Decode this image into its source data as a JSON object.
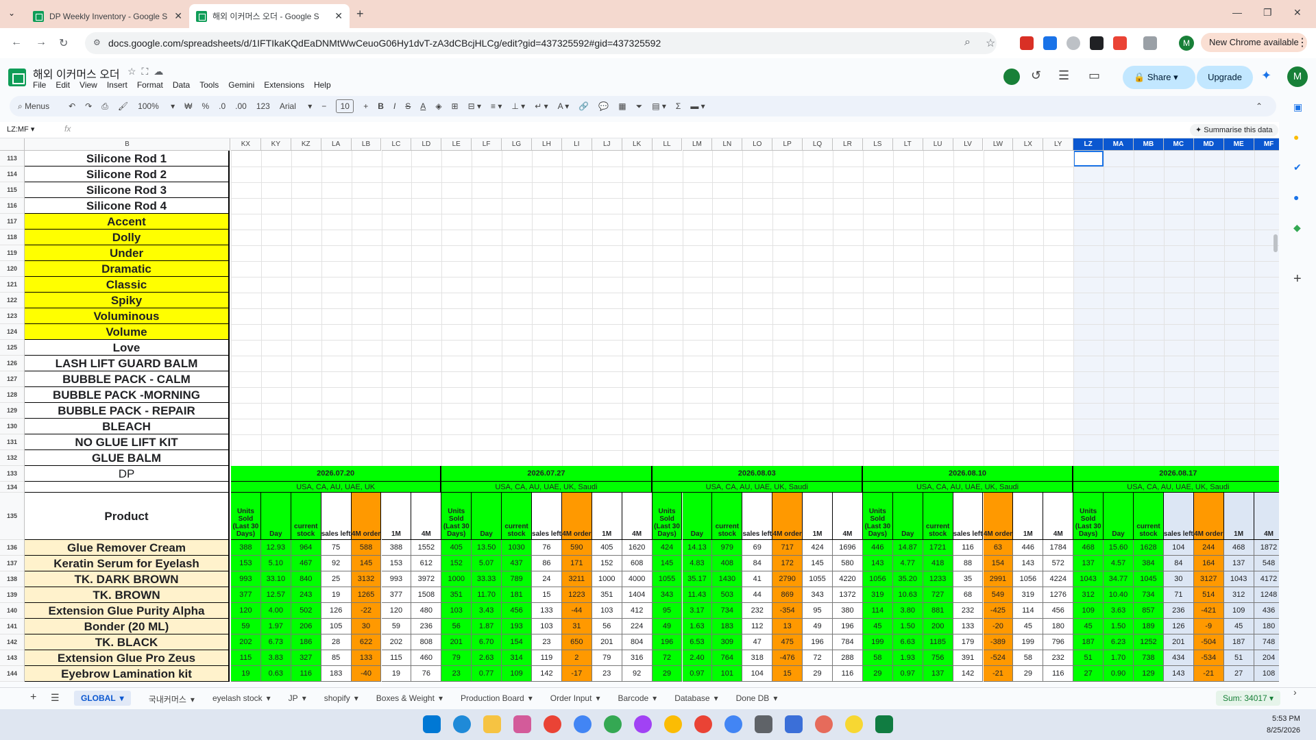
{
  "browser": {
    "tabs": [
      {
        "title": "DP Weekly Inventory - Google S",
        "active": false
      },
      {
        "title": "해외 이커머스 오더 - Google S",
        "active": true
      }
    ],
    "url": "docs.google.com/spreadsheets/d/1IFTIkaKQdEaDNMtWwCeuoG06Hy1dvT-zA3dCBcjHLCg/edit?gid=437325592#gid=437325592",
    "new_chrome_label": "New Chrome available",
    "profile_initial": "M"
  },
  "doc": {
    "title": "해외 이커머스 오더",
    "menu": [
      "File",
      "Edit",
      "View",
      "Insert",
      "Format",
      "Data",
      "Tools",
      "Gemini",
      "Extensions",
      "Help"
    ],
    "share_label": "Share",
    "upgrade_label": "Upgrade",
    "user_initial": "M"
  },
  "toolbar": {
    "menus_label": "Menus",
    "zoom": "100%",
    "font": "Arial",
    "font_size": "10",
    "format_number": "123"
  },
  "formula_bar": {
    "name_box": "LZ:MF",
    "fx": "fx",
    "summarise": "Summarise this data"
  },
  "columns": [
    "KX",
    "KY",
    "KZ",
    "LA",
    "LB",
    "LC",
    "LD",
    "LE",
    "LF",
    "LG",
    "LH",
    "LI",
    "LJ",
    "LK",
    "LL",
    "LM",
    "LN",
    "LO",
    "LP",
    "LQ",
    "LR",
    "LS",
    "LT",
    "LU",
    "LV",
    "LW",
    "LX",
    "LY",
    "LZ",
    "MA",
    "MB",
    "MC",
    "MD",
    "ME",
    "MF"
  ],
  "col_b_header": "B",
  "rows_upper": [
    {
      "n": "113",
      "label": "Silicone Rod 1",
      "style": "white"
    },
    {
      "n": "114",
      "label": "Silicone Rod 2",
      "style": "white"
    },
    {
      "n": "115",
      "label": "Silicone Rod 3",
      "style": "white"
    },
    {
      "n": "116",
      "label": "Silicone Rod 4",
      "style": "white"
    },
    {
      "n": "117",
      "label": "Accent",
      "style": "yellow"
    },
    {
      "n": "118",
      "label": "Dolly",
      "style": "yellow"
    },
    {
      "n": "119",
      "label": "Under",
      "style": "yellow"
    },
    {
      "n": "120",
      "label": "Dramatic",
      "style": "yellow"
    },
    {
      "n": "121",
      "label": "Classic",
      "style": "yellow"
    },
    {
      "n": "122",
      "label": "Spiky",
      "style": "yellow"
    },
    {
      "n": "123",
      "label": "Voluminous",
      "style": "yellow"
    },
    {
      "n": "124",
      "label": "Volume",
      "style": "yellow"
    },
    {
      "n": "125",
      "label": "Love",
      "style": "white"
    },
    {
      "n": "126",
      "label": "LASH LIFT GUARD BALM",
      "style": "white"
    },
    {
      "n": "127",
      "label": "BUBBLE PACK - CALM",
      "style": "white"
    },
    {
      "n": "128",
      "label": "BUBBLE PACK -MORNING",
      "style": "white"
    },
    {
      "n": "129",
      "label": "BUBBLE PACK - REPAIR",
      "style": "white"
    },
    {
      "n": "130",
      "label": "BLEACH",
      "style": "white"
    },
    {
      "n": "131",
      "label": "NO GLUE LIFT KIT",
      "style": "white"
    },
    {
      "n": "132",
      "label": "GLUE BALM",
      "style": "white"
    }
  ],
  "row133": {
    "n": "133",
    "label": "DP"
  },
  "row134": {
    "n": "134"
  },
  "row135": {
    "n": "135",
    "label": "Product"
  },
  "weeks": [
    {
      "date": "2026.07.20",
      "region": "USA, CA, AU, UAE, UK"
    },
    {
      "date": "2026.07.27",
      "region": "USA, CA, AU, UAE, UK, Saudi"
    },
    {
      "date": "2026.08.03",
      "region": "USA, CA, AU, UAE, UK, Saudi"
    },
    {
      "date": "2026.08.10",
      "region": "USA, CA, AU, UAE, UK, Saudi"
    },
    {
      "date": "2026.08.17",
      "region": "USA, CA, AU, UAE, UK, Saudi"
    }
  ],
  "subheaders": [
    "Units Sold (Last 30 Days)",
    "Day",
    "current stock",
    "sales left",
    "4M order",
    "1M",
    "4M"
  ],
  "products": [
    {
      "n": "136",
      "name": "Glue Remover Cream",
      "v": [
        [
          "388",
          "12.93",
          "964",
          "75",
          "588",
          "388",
          "1552"
        ],
        [
          "405",
          "13.50",
          "1030",
          "76",
          "590",
          "405",
          "1620"
        ],
        [
          "424",
          "14.13",
          "979",
          "69",
          "717",
          "424",
          "1696"
        ],
        [
          "446",
          "14.87",
          "1721",
          "116",
          "63",
          "446",
          "1784"
        ],
        [
          "468",
          "15.60",
          "1628",
          "104",
          "244",
          "468",
          "1872"
        ]
      ]
    },
    {
      "n": "137",
      "name": "Keratin Serum for Eyelash",
      "v": [
        [
          "153",
          "5.10",
          "467",
          "92",
          "145",
          "153",
          "612"
        ],
        [
          "152",
          "5.07",
          "437",
          "86",
          "171",
          "152",
          "608"
        ],
        [
          "145",
          "4.83",
          "408",
          "84",
          "172",
          "145",
          "580"
        ],
        [
          "143",
          "4.77",
          "418",
          "88",
          "154",
          "143",
          "572"
        ],
        [
          "137",
          "4.57",
          "384",
          "84",
          "164",
          "137",
          "548"
        ]
      ]
    },
    {
      "n": "138",
      "name": "TK. DARK BROWN",
      "v": [
        [
          "993",
          "33.10",
          "840",
          "25",
          "3132",
          "993",
          "3972"
        ],
        [
          "1000",
          "33.33",
          "789",
          "24",
          "3211",
          "1000",
          "4000"
        ],
        [
          "1055",
          "35.17",
          "1430",
          "41",
          "2790",
          "1055",
          "4220"
        ],
        [
          "1056",
          "35.20",
          "1233",
          "35",
          "2991",
          "1056",
          "4224"
        ],
        [
          "1043",
          "34.77",
          "1045",
          "30",
          "3127",
          "1043",
          "4172"
        ]
      ]
    },
    {
      "n": "139",
      "name": "TK. BROWN",
      "v": [
        [
          "377",
          "12.57",
          "243",
          "19",
          "1265",
          "377",
          "1508"
        ],
        [
          "351",
          "11.70",
          "181",
          "15",
          "1223",
          "351",
          "1404"
        ],
        [
          "343",
          "11.43",
          "503",
          "44",
          "869",
          "343",
          "1372"
        ],
        [
          "319",
          "10.63",
          "727",
          "68",
          "549",
          "319",
          "1276"
        ],
        [
          "312",
          "10.40",
          "734",
          "71",
          "514",
          "312",
          "1248"
        ]
      ]
    },
    {
      "n": "140",
      "name": "Extension Glue Purity Alpha",
      "v": [
        [
          "120",
          "4.00",
          "502",
          "126",
          "-22",
          "120",
          "480"
        ],
        [
          "103",
          "3.43",
          "456",
          "133",
          "-44",
          "103",
          "412"
        ],
        [
          "95",
          "3.17",
          "734",
          "232",
          "-354",
          "95",
          "380"
        ],
        [
          "114",
          "3.80",
          "881",
          "232",
          "-425",
          "114",
          "456"
        ],
        [
          "109",
          "3.63",
          "857",
          "236",
          "-421",
          "109",
          "436"
        ]
      ]
    },
    {
      "n": "141",
      "name": "Bonder (20 ML)",
      "v": [
        [
          "59",
          "1.97",
          "206",
          "105",
          "30",
          "59",
          "236"
        ],
        [
          "56",
          "1.87",
          "193",
          "103",
          "31",
          "56",
          "224"
        ],
        [
          "49",
          "1.63",
          "183",
          "112",
          "13",
          "49",
          "196"
        ],
        [
          "45",
          "1.50",
          "200",
          "133",
          "-20",
          "45",
          "180"
        ],
        [
          "45",
          "1.50",
          "189",
          "126",
          "-9",
          "45",
          "180"
        ]
      ]
    },
    {
      "n": "142",
      "name": "TK. BLACK",
      "v": [
        [
          "202",
          "6.73",
          "186",
          "28",
          "622",
          "202",
          "808"
        ],
        [
          "201",
          "6.70",
          "154",
          "23",
          "650",
          "201",
          "804"
        ],
        [
          "196",
          "6.53",
          "309",
          "47",
          "475",
          "196",
          "784"
        ],
        [
          "199",
          "6.63",
          "1185",
          "179",
          "-389",
          "199",
          "796"
        ],
        [
          "187",
          "6.23",
          "1252",
          "201",
          "-504",
          "187",
          "748"
        ]
      ]
    },
    {
      "n": "143",
      "name": "Extension Glue Pro Zeus",
      "v": [
        [
          "115",
          "3.83",
          "327",
          "85",
          "133",
          "115",
          "460"
        ],
        [
          "79",
          "2.63",
          "314",
          "119",
          "2",
          "79",
          "316"
        ],
        [
          "72",
          "2.40",
          "764",
          "318",
          "-476",
          "72",
          "288"
        ],
        [
          "58",
          "1.93",
          "756",
          "391",
          "-524",
          "58",
          "232"
        ],
        [
          "51",
          "1.70",
          "738",
          "434",
          "-534",
          "51",
          "204"
        ]
      ]
    },
    {
      "n": "144",
      "name": "Eyebrow Lamination kit",
      "v": [
        [
          "19",
          "0.63",
          "116",
          "183",
          "-40",
          "19",
          "76"
        ],
        [
          "23",
          "0.77",
          "109",
          "142",
          "-17",
          "23",
          "92"
        ],
        [
          "29",
          "0.97",
          "101",
          "104",
          "15",
          "29",
          "116"
        ],
        [
          "29",
          "0.97",
          "137",
          "142",
          "-21",
          "29",
          "116"
        ],
        [
          "27",
          "0.90",
          "129",
          "143",
          "-21",
          "27",
          "108"
        ]
      ]
    }
  ],
  "sheets": [
    {
      "label": "GLOBAL",
      "active": true
    },
    {
      "label": "국내커머스",
      "active": false
    },
    {
      "label": "eyelash stock",
      "active": false
    },
    {
      "label": "JP",
      "active": false
    },
    {
      "label": "shopify",
      "active": false
    },
    {
      "label": "Boxes & Weight",
      "active": false
    },
    {
      "label": "Production Board",
      "active": false
    },
    {
      "label": "Order Input",
      "active": false
    },
    {
      "label": "Barcode",
      "active": false
    },
    {
      "label": "Database",
      "active": false
    },
    {
      "label": "Done DB",
      "active": false
    }
  ],
  "sum_label": "Sum: 34017",
  "clock": {
    "time": "5:53 PM",
    "date": "8/25/2026"
  },
  "colors": {
    "green": "#00ff00",
    "orange": "#ff9900",
    "yellow": "#ffff00",
    "cream": "#fff2cc",
    "selection": "#0b57d0"
  }
}
